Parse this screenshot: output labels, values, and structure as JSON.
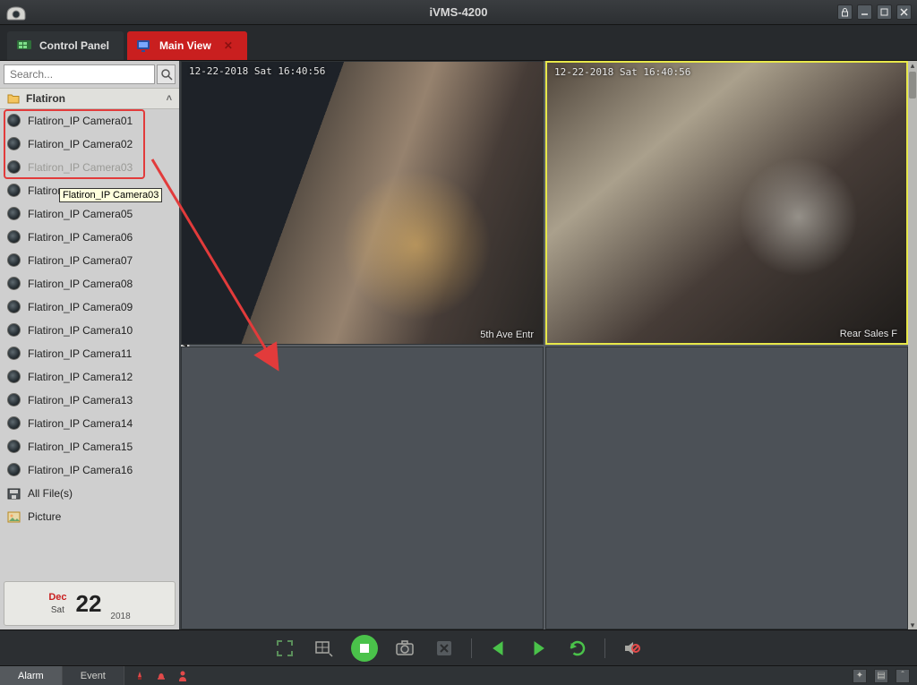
{
  "app": {
    "title": "iVMS-4200"
  },
  "tabs": {
    "control_panel": "Control Panel",
    "main_view": "Main View"
  },
  "sidebar": {
    "search_placeholder": "Search...",
    "group_name": "Flatiron",
    "cameras": [
      "Flatiron_IP Camera01",
      "Flatiron_IP Camera02",
      "Flatiron_IP Camera03",
      "Flatiron_IP Camera04",
      "Flatiron_IP Camera05",
      "Flatiron_IP Camera06",
      "Flatiron_IP Camera07",
      "Flatiron_IP Camera08",
      "Flatiron_IP Camera09",
      "Flatiron_IP Camera10",
      "Flatiron_IP Camera11",
      "Flatiron_IP Camera12",
      "Flatiron_IP Camera13",
      "Flatiron_IP Camera14",
      "Flatiron_IP Camera15",
      "Flatiron_IP Camera16"
    ],
    "camera4_partial_label": "Flatiron",
    "tooltip": "Flatiron_IP Camera03",
    "all_files": "All File(s)",
    "picture": "Picture"
  },
  "date": {
    "month": "Dec",
    "dow": "Sat",
    "day": "22",
    "year": "2018"
  },
  "feeds": {
    "feed1_timestamp": "12-22-2018 Sat 16:40:56",
    "feed1_camname": "5th Ave Entr",
    "feed2_timestamp": "12-22-2018 Sat 16:40:56",
    "feed2_camname": "Rear Sales F"
  },
  "footer": {
    "alarm": "Alarm",
    "event": "Event"
  }
}
